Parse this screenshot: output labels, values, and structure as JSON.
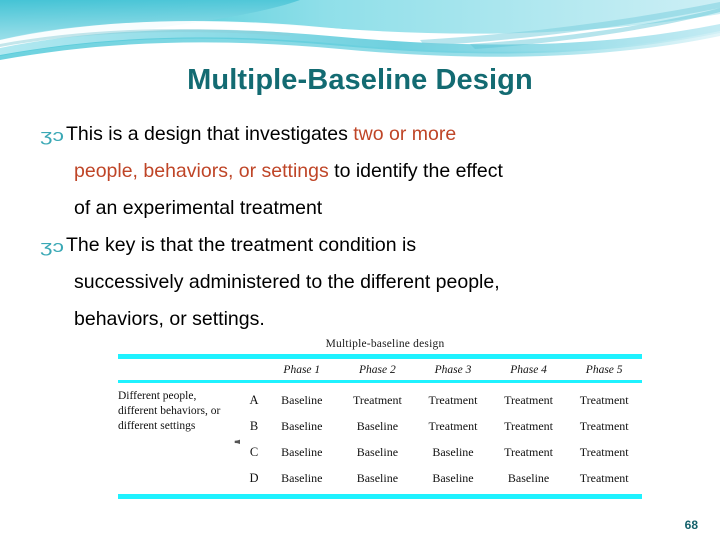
{
  "slide": {
    "title": "Multiple-Baseline Design",
    "page_number": "68",
    "accent_color": "#136b72",
    "highlight_color": "#bf4527",
    "rule_color": "#1ff2ff",
    "bullet_glyph": "ʒɔ"
  },
  "bullets": [
    {
      "marker": "ʒɔ",
      "lines": [
        [
          {
            "text": "This is a design that investigates ",
            "style": "normal"
          },
          {
            "text": "two or more",
            "style": "highlight"
          }
        ],
        [
          {
            "text": "people, behaviors, or settings",
            "style": "highlight"
          },
          {
            "text": " to identify the effect",
            "style": "normal"
          }
        ],
        [
          {
            "text": "of an experimental treatment",
            "style": "normal"
          }
        ]
      ]
    },
    {
      "marker": "ʒɔ",
      "lines": [
        [
          {
            "text": " The key is that the treatment condition is",
            "style": "normal"
          }
        ],
        [
          {
            "text": "successively administered to the different people,",
            "style": "normal"
          }
        ],
        [
          {
            "text": "behaviors, or settings.",
            "style": "normal"
          }
        ]
      ]
    }
  ],
  "figure": {
    "caption": "Multiple-baseline design",
    "stub_label": "Different people, different behaviors, or different settings",
    "brace_glyph": "{",
    "column_headers": [
      "",
      "Phase 1",
      "Phase 2",
      "Phase 3",
      "Phase 4",
      "Phase 5"
    ],
    "rows": [
      {
        "id": "A",
        "cells": [
          "Baseline",
          "Treatment",
          "Treatment",
          "Treatment",
          "Treatment"
        ]
      },
      {
        "id": "B",
        "cells": [
          "Baseline",
          "Baseline",
          "Treatment",
          "Treatment",
          "Treatment"
        ]
      },
      {
        "id": "C",
        "cells": [
          "Baseline",
          "Baseline",
          "Baseline",
          "Treatment",
          "Treatment"
        ]
      },
      {
        "id": "D",
        "cells": [
          "Baseline",
          "Baseline",
          "Baseline",
          "Baseline",
          "Treatment"
        ]
      }
    ]
  }
}
